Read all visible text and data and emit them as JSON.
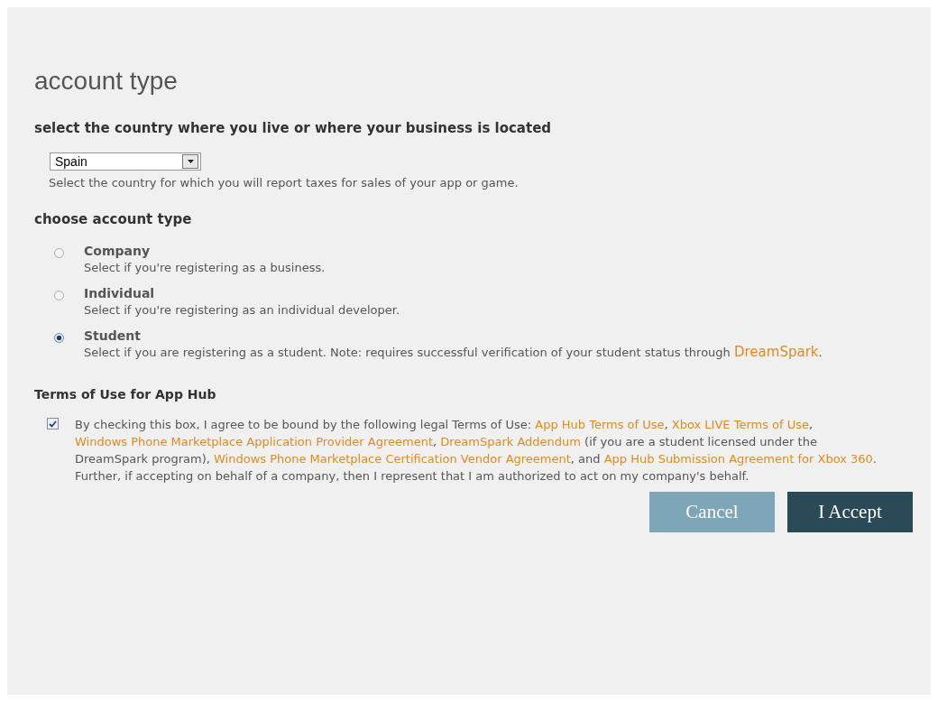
{
  "title": "account type",
  "country": {
    "heading": "select the country where you live or where your business is located",
    "value": "Spain",
    "hint": "Select the country for which you will report taxes for sales of your app or game."
  },
  "account": {
    "heading": "choose account type",
    "options": [
      {
        "label": "Company",
        "selected": false,
        "description": [
          {
            "kind": "text",
            "text": "Select if you're registering as a business."
          }
        ]
      },
      {
        "label": "Individual",
        "selected": false,
        "description": [
          {
            "kind": "text",
            "text": "Select if you're registering as an individual developer."
          }
        ]
      },
      {
        "label": "Student",
        "selected": true,
        "description": [
          {
            "kind": "text",
            "text": "Select if you are registering as a student. Note: requires successful verification of your student status through "
          },
          {
            "kind": "link",
            "text": "DreamSpark"
          },
          {
            "kind": "text",
            "text": "."
          }
        ]
      }
    ]
  },
  "terms": {
    "heading": "Terms of Use for App Hub",
    "checked": true,
    "text": [
      {
        "kind": "text",
        "text": "By checking this box, I agree to be bound by the following legal Terms of Use: "
      },
      {
        "kind": "link",
        "text": "App Hub Terms of Use"
      },
      {
        "kind": "text",
        "text": ", "
      },
      {
        "kind": "link",
        "text": "Xbox LIVE Terms of Use"
      },
      {
        "kind": "text",
        "text": ", "
      },
      {
        "kind": "link",
        "text": "Windows Phone Marketplace Application Provider Agreement"
      },
      {
        "kind": "text",
        "text": ", "
      },
      {
        "kind": "link",
        "text": "DreamSpark Addendum"
      },
      {
        "kind": "text",
        "text": " (if you are a student licensed under the DreamSpark program), "
      },
      {
        "kind": "link",
        "text": "Windows Phone Marketplace Certification Vendor Agreement"
      },
      {
        "kind": "text",
        "text": ", and "
      },
      {
        "kind": "link",
        "text": "App Hub Submission Agreement for Xbox 360"
      },
      {
        "kind": "text",
        "text": ". Further, if accepting on behalf of a company, then I represent that I am authorized to act on my company's behalf."
      }
    ]
  },
  "buttons": [
    {
      "label": "Cancel",
      "kind": "secondary"
    },
    {
      "label": "I Accept",
      "kind": "primary"
    }
  ]
}
